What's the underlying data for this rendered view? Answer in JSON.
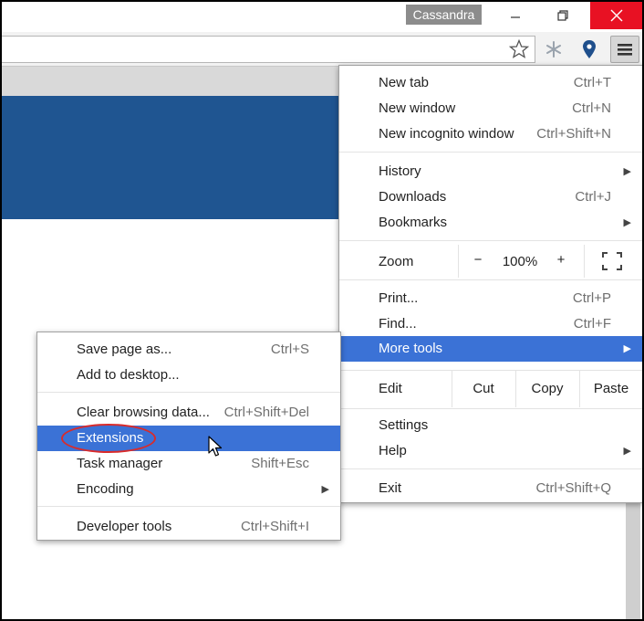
{
  "window": {
    "profile_name": "Cassandra"
  },
  "toolbar": {
    "icons": [
      "star-icon",
      "snowflake-extension-icon",
      "map-pin-extension-icon",
      "hamburger-menu-icon"
    ]
  },
  "colors": {
    "banner": "#1f5591",
    "highlight": "#3b72d6",
    "close": "#e81123",
    "ring": "#d92b2b"
  },
  "main_menu": {
    "new_tab": {
      "label": "New tab",
      "shortcut": "Ctrl+T"
    },
    "new_window": {
      "label": "New window",
      "shortcut": "Ctrl+N"
    },
    "new_incognito": {
      "label": "New incognito window",
      "shortcut": "Ctrl+Shift+N"
    },
    "history": {
      "label": "History"
    },
    "downloads": {
      "label": "Downloads",
      "shortcut": "Ctrl+J"
    },
    "bookmarks": {
      "label": "Bookmarks"
    },
    "zoom": {
      "label": "Zoom",
      "minus": "−",
      "value": "100%",
      "plus": "+"
    },
    "print": {
      "label": "Print...",
      "shortcut": "Ctrl+P"
    },
    "find": {
      "label": "Find...",
      "shortcut": "Ctrl+F"
    },
    "more_tools": {
      "label": "More tools"
    },
    "edit": {
      "label": "Edit",
      "cut": "Cut",
      "copy": "Copy",
      "paste": "Paste"
    },
    "settings": {
      "label": "Settings"
    },
    "help": {
      "label": "Help"
    },
    "exit": {
      "label": "Exit",
      "shortcut": "Ctrl+Shift+Q"
    }
  },
  "sub_menu": {
    "save_page": {
      "label": "Save page as...",
      "shortcut": "Ctrl+S"
    },
    "add_desktop": {
      "label": "Add to desktop..."
    },
    "clear_data": {
      "label": "Clear browsing data...",
      "shortcut": "Ctrl+Shift+Del"
    },
    "extensions": {
      "label": "Extensions"
    },
    "task_manager": {
      "label": "Task manager",
      "shortcut": "Shift+Esc"
    },
    "encoding": {
      "label": "Encoding"
    },
    "dev_tools": {
      "label": "Developer tools",
      "shortcut": "Ctrl+Shift+I"
    }
  }
}
